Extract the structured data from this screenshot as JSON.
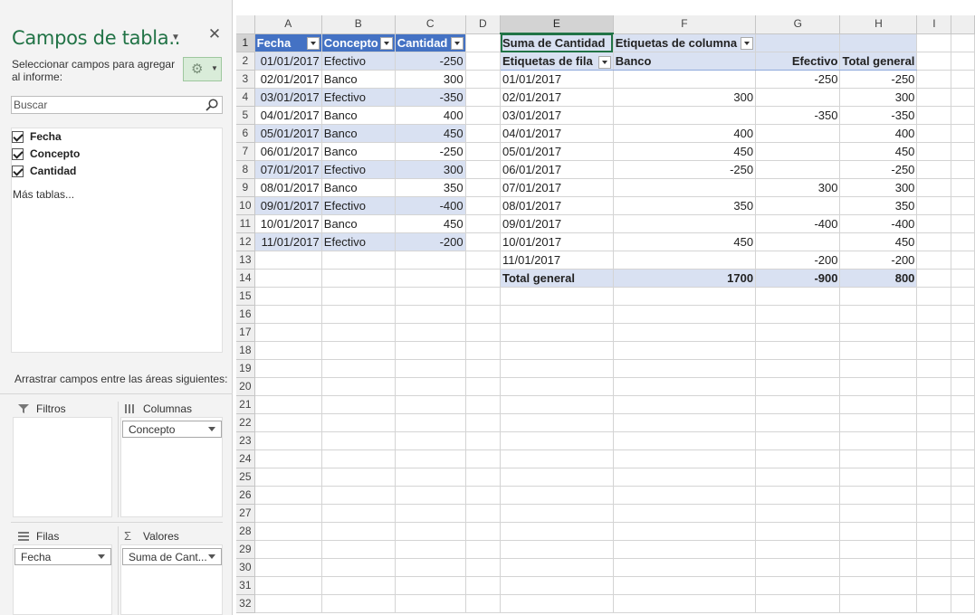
{
  "pane": {
    "title": "Campos de tabla..",
    "close_glyph": "✕",
    "description": "Seleccionar campos para agregar al informe:",
    "search_placeholder": "Buscar",
    "fields": [
      {
        "label": "Fecha",
        "checked": true
      },
      {
        "label": "Concepto",
        "checked": true
      },
      {
        "label": "Cantidad",
        "checked": true
      }
    ],
    "more_tables": "Más tablas...",
    "drag_hint": "Arrastrar campos entre las áreas siguientes:",
    "areas": {
      "filters": {
        "label": "Filtros",
        "icon": "filter-icon"
      },
      "columns": {
        "label": "Columnas",
        "icon": "columns-icon",
        "chip": "Concepto"
      },
      "rows": {
        "label": "Filas",
        "icon": "rows-icon",
        "chip": "Fecha"
      },
      "values": {
        "label": "Valores",
        "icon": "sigma-icon",
        "chip": "Suma de Cant..."
      }
    }
  },
  "grid": {
    "columns": [
      "A",
      "B",
      "C",
      "D",
      "E",
      "F",
      "G",
      "H",
      "I"
    ],
    "selected_column": "E",
    "selected_row": 1,
    "row_count": 32,
    "table": {
      "headers": [
        "Fecha",
        "Concepto",
        "Cantidad"
      ],
      "rows": [
        [
          "01/01/2017",
          "Efectivo",
          "-250"
        ],
        [
          "02/01/2017",
          "Banco",
          "300"
        ],
        [
          "03/01/2017",
          "Efectivo",
          "-350"
        ],
        [
          "04/01/2017",
          "Banco",
          "400"
        ],
        [
          "05/01/2017",
          "Banco",
          "450"
        ],
        [
          "06/01/2017",
          "Banco",
          "-250"
        ],
        [
          "07/01/2017",
          "Efectivo",
          "300"
        ],
        [
          "08/01/2017",
          "Banco",
          "350"
        ],
        [
          "09/01/2017",
          "Efectivo",
          "-400"
        ],
        [
          "10/01/2017",
          "Banco",
          "450"
        ],
        [
          "11/01/2017",
          "Efectivo",
          "-200"
        ]
      ]
    },
    "pivot": {
      "value_label": "Suma de Cantidad",
      "column_labels": "Etiquetas de columna",
      "row_labels": "Etiquetas de fila",
      "column_headers": [
        "Banco",
        "Efectivo",
        "Total general"
      ],
      "rows": [
        [
          "01/01/2017",
          "",
          "-250",
          "-250"
        ],
        [
          "02/01/2017",
          "300",
          "",
          "300"
        ],
        [
          "03/01/2017",
          "",
          "-350",
          "-350"
        ],
        [
          "04/01/2017",
          "400",
          "",
          "400"
        ],
        [
          "05/01/2017",
          "450",
          "",
          "450"
        ],
        [
          "06/01/2017",
          "-250",
          "",
          "-250"
        ],
        [
          "07/01/2017",
          "",
          "300",
          "300"
        ],
        [
          "08/01/2017",
          "350",
          "",
          "350"
        ],
        [
          "09/01/2017",
          "",
          "-400",
          "-400"
        ],
        [
          "10/01/2017",
          "450",
          "",
          "450"
        ],
        [
          "11/01/2017",
          "",
          "-200",
          "-200"
        ]
      ],
      "total_label": "Total general",
      "totals": [
        "1700",
        "-900",
        "800"
      ]
    }
  }
}
